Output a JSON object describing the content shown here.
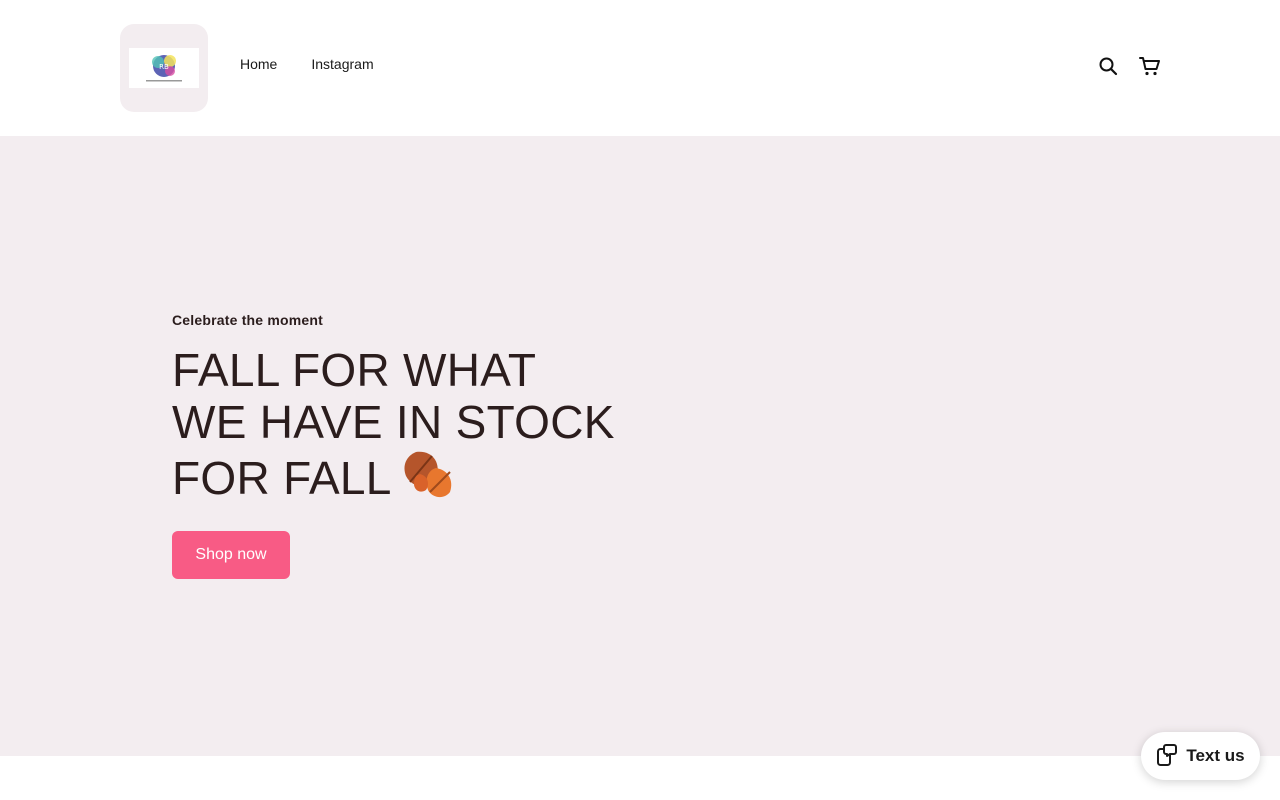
{
  "header": {
    "logo_alt": "The Refresh Boutique",
    "nav": [
      {
        "label": "Home"
      },
      {
        "label": "Instagram"
      }
    ],
    "icons": [
      "search-icon",
      "cart-icon"
    ],
    "brand_art_text": "RB"
  },
  "hero": {
    "eyebrow": "Celebrate the moment",
    "headline_lines": [
      "FALL FOR WHAT",
      "WE HAVE IN STOCK",
      "FOR FALL"
    ],
    "headline_emoji": "fallen-leaf-icon",
    "cta_label": "Shop now",
    "background_color": "#f3edf0",
    "cta_color": "#f85b85"
  },
  "widget": {
    "label": "Text us"
  }
}
